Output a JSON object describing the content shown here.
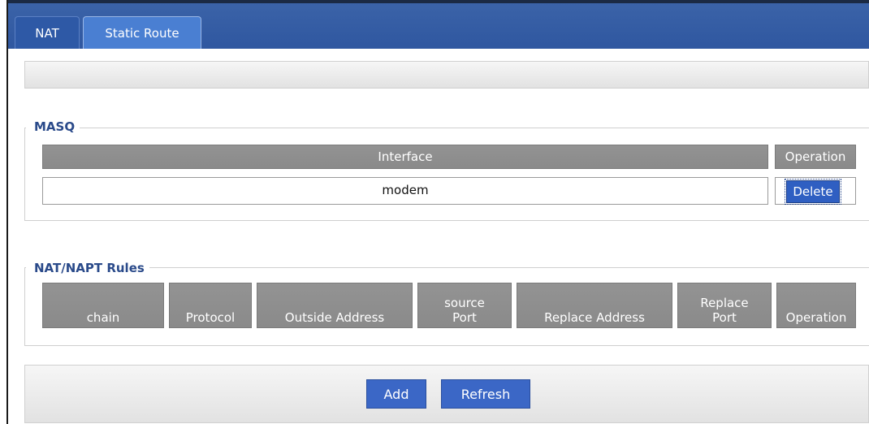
{
  "tabs": [
    {
      "label": "NAT"
    },
    {
      "label": "Static Route"
    }
  ],
  "masq": {
    "legend": "MASQ",
    "columns": [
      "Interface",
      "Operation"
    ],
    "rows": [
      {
        "interface": "modem",
        "action": "Delete"
      }
    ]
  },
  "rules": {
    "legend": "NAT/NAPT Rules",
    "columns": [
      {
        "top": "",
        "bottom": "chain"
      },
      {
        "top": "",
        "bottom": "Protocol"
      },
      {
        "top": "",
        "bottom": "Outside Address"
      },
      {
        "top": "source",
        "bottom": "Port"
      },
      {
        "top": "",
        "bottom": "Replace Address"
      },
      {
        "top": "Replace",
        "bottom": "Port"
      },
      {
        "top": "",
        "bottom": "Operation"
      }
    ]
  },
  "actions": {
    "add": "Add",
    "refresh": "Refresh"
  },
  "colors": {
    "accent": "#2f57a0",
    "header_gray": "#8f8f8f",
    "legend_text": "#2a4a8a",
    "button": "#3b67c6"
  }
}
